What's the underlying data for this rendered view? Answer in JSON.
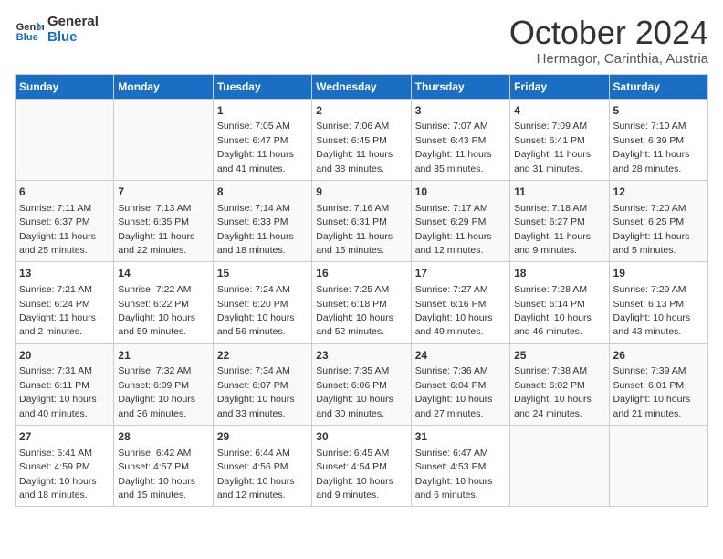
{
  "header": {
    "logo_line1": "General",
    "logo_line2": "Blue",
    "month": "October 2024",
    "location": "Hermagor, Carinthia, Austria"
  },
  "days_of_week": [
    "Sunday",
    "Monday",
    "Tuesday",
    "Wednesday",
    "Thursday",
    "Friday",
    "Saturday"
  ],
  "weeks": [
    [
      {
        "day": "",
        "info": ""
      },
      {
        "day": "",
        "info": ""
      },
      {
        "day": "1",
        "info": "Sunrise: 7:05 AM\nSunset: 6:47 PM\nDaylight: 11 hours and 41 minutes."
      },
      {
        "day": "2",
        "info": "Sunrise: 7:06 AM\nSunset: 6:45 PM\nDaylight: 11 hours and 38 minutes."
      },
      {
        "day": "3",
        "info": "Sunrise: 7:07 AM\nSunset: 6:43 PM\nDaylight: 11 hours and 35 minutes."
      },
      {
        "day": "4",
        "info": "Sunrise: 7:09 AM\nSunset: 6:41 PM\nDaylight: 11 hours and 31 minutes."
      },
      {
        "day": "5",
        "info": "Sunrise: 7:10 AM\nSunset: 6:39 PM\nDaylight: 11 hours and 28 minutes."
      }
    ],
    [
      {
        "day": "6",
        "info": "Sunrise: 7:11 AM\nSunset: 6:37 PM\nDaylight: 11 hours and 25 minutes."
      },
      {
        "day": "7",
        "info": "Sunrise: 7:13 AM\nSunset: 6:35 PM\nDaylight: 11 hours and 22 minutes."
      },
      {
        "day": "8",
        "info": "Sunrise: 7:14 AM\nSunset: 6:33 PM\nDaylight: 11 hours and 18 minutes."
      },
      {
        "day": "9",
        "info": "Sunrise: 7:16 AM\nSunset: 6:31 PM\nDaylight: 11 hours and 15 minutes."
      },
      {
        "day": "10",
        "info": "Sunrise: 7:17 AM\nSunset: 6:29 PM\nDaylight: 11 hours and 12 minutes."
      },
      {
        "day": "11",
        "info": "Sunrise: 7:18 AM\nSunset: 6:27 PM\nDaylight: 11 hours and 9 minutes."
      },
      {
        "day": "12",
        "info": "Sunrise: 7:20 AM\nSunset: 6:25 PM\nDaylight: 11 hours and 5 minutes."
      }
    ],
    [
      {
        "day": "13",
        "info": "Sunrise: 7:21 AM\nSunset: 6:24 PM\nDaylight: 11 hours and 2 minutes."
      },
      {
        "day": "14",
        "info": "Sunrise: 7:22 AM\nSunset: 6:22 PM\nDaylight: 10 hours and 59 minutes."
      },
      {
        "day": "15",
        "info": "Sunrise: 7:24 AM\nSunset: 6:20 PM\nDaylight: 10 hours and 56 minutes."
      },
      {
        "day": "16",
        "info": "Sunrise: 7:25 AM\nSunset: 6:18 PM\nDaylight: 10 hours and 52 minutes."
      },
      {
        "day": "17",
        "info": "Sunrise: 7:27 AM\nSunset: 6:16 PM\nDaylight: 10 hours and 49 minutes."
      },
      {
        "day": "18",
        "info": "Sunrise: 7:28 AM\nSunset: 6:14 PM\nDaylight: 10 hours and 46 minutes."
      },
      {
        "day": "19",
        "info": "Sunrise: 7:29 AM\nSunset: 6:13 PM\nDaylight: 10 hours and 43 minutes."
      }
    ],
    [
      {
        "day": "20",
        "info": "Sunrise: 7:31 AM\nSunset: 6:11 PM\nDaylight: 10 hours and 40 minutes."
      },
      {
        "day": "21",
        "info": "Sunrise: 7:32 AM\nSunset: 6:09 PM\nDaylight: 10 hours and 36 minutes."
      },
      {
        "day": "22",
        "info": "Sunrise: 7:34 AM\nSunset: 6:07 PM\nDaylight: 10 hours and 33 minutes."
      },
      {
        "day": "23",
        "info": "Sunrise: 7:35 AM\nSunset: 6:06 PM\nDaylight: 10 hours and 30 minutes."
      },
      {
        "day": "24",
        "info": "Sunrise: 7:36 AM\nSunset: 6:04 PM\nDaylight: 10 hours and 27 minutes."
      },
      {
        "day": "25",
        "info": "Sunrise: 7:38 AM\nSunset: 6:02 PM\nDaylight: 10 hours and 24 minutes."
      },
      {
        "day": "26",
        "info": "Sunrise: 7:39 AM\nSunset: 6:01 PM\nDaylight: 10 hours and 21 minutes."
      }
    ],
    [
      {
        "day": "27",
        "info": "Sunrise: 6:41 AM\nSunset: 4:59 PM\nDaylight: 10 hours and 18 minutes."
      },
      {
        "day": "28",
        "info": "Sunrise: 6:42 AM\nSunset: 4:57 PM\nDaylight: 10 hours and 15 minutes."
      },
      {
        "day": "29",
        "info": "Sunrise: 6:44 AM\nSunset: 4:56 PM\nDaylight: 10 hours and 12 minutes."
      },
      {
        "day": "30",
        "info": "Sunrise: 6:45 AM\nSunset: 4:54 PM\nDaylight: 10 hours and 9 minutes."
      },
      {
        "day": "31",
        "info": "Sunrise: 6:47 AM\nSunset: 4:53 PM\nDaylight: 10 hours and 6 minutes."
      },
      {
        "day": "",
        "info": ""
      },
      {
        "day": "",
        "info": ""
      }
    ]
  ]
}
